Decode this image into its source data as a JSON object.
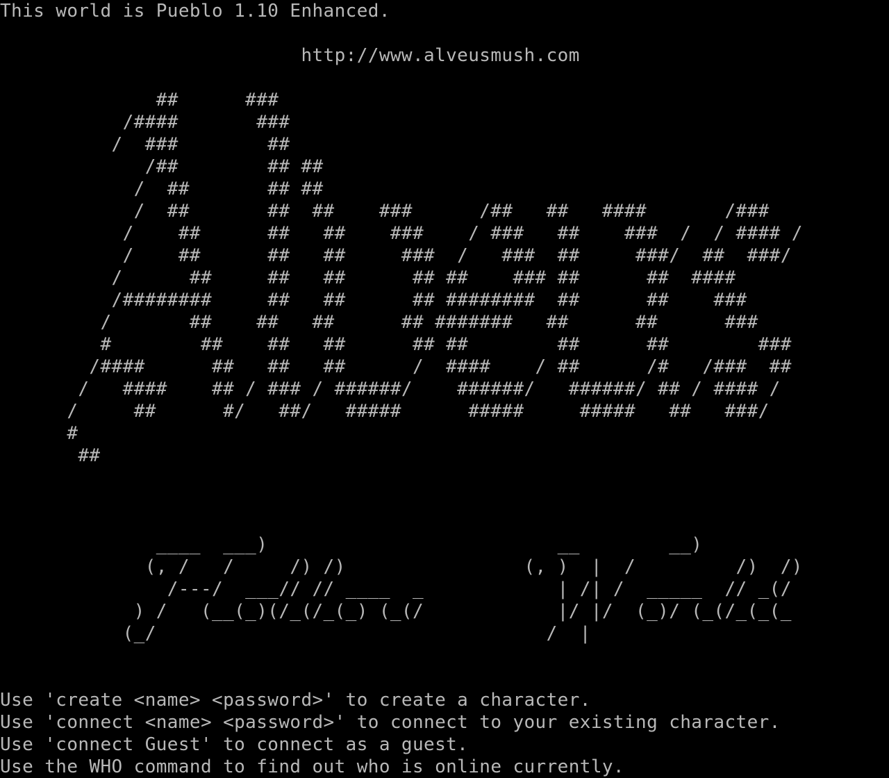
{
  "terminal": {
    "colors": {
      "background": "#000000",
      "foreground": "#b8b8b8"
    },
    "lines": [
      "This world is Pueblo 1.10 Enhanced.",
      "",
      "                           http://www.alveusmush.com",
      "",
      "              ##      ###",
      "           /####       ###",
      "          /  ###        ##",
      "             /##        ## ##",
      "            /  ##       ## ##",
      "            /  ##       ##  ##    ###      /##   ##   ####       /###",
      "           /    ##      ##   ##    ###    / ###   ##    ###  /  / #### /",
      "           /    ##      ##   ##     ###  /   ###  ##     ###/  ##  ###/",
      "          /      ##     ##   ##      ## ##    ### ##      ##  ####",
      "          /########     ##   ##      ## ########  ##      ##    ###",
      "         /       ##    ##   ##      ## #######   ##      ##      ###",
      "         #        ##    ##   ##      ## ##        ##      ##        ###",
      "        /####      ##   ##   ##      /  ####    / ##      /#   /###  ##",
      "       /   ####    ## / ### / ######/    ######/   ######/ ## / #### /",
      "      /     ##      #/   ##/   #####      #####     #####   ##   ###/",
      "      #",
      "       ##",
      "",
      "",
      "",
      "              ____  ___)                          __        __)",
      "             (, /   /     /) /)                (, )  |  /         /)  /)",
      "               /---/  ___// // ____  _            | /| /  _____  // _(/",
      "            ) /   (__(_)(/_(/_(_) (_(/            |/ |/  (_)/ (_(/_(_(_",
      "           (_/                                   /  |",
      "",
      "",
      "Use 'create <name> <password>' to create a character.",
      "Use 'connect <name> <password>' to connect to your existing character.",
      "Use 'connect Guest' to connect as a guest.",
      "Use the WHO command to find out who is online currently."
    ]
  }
}
